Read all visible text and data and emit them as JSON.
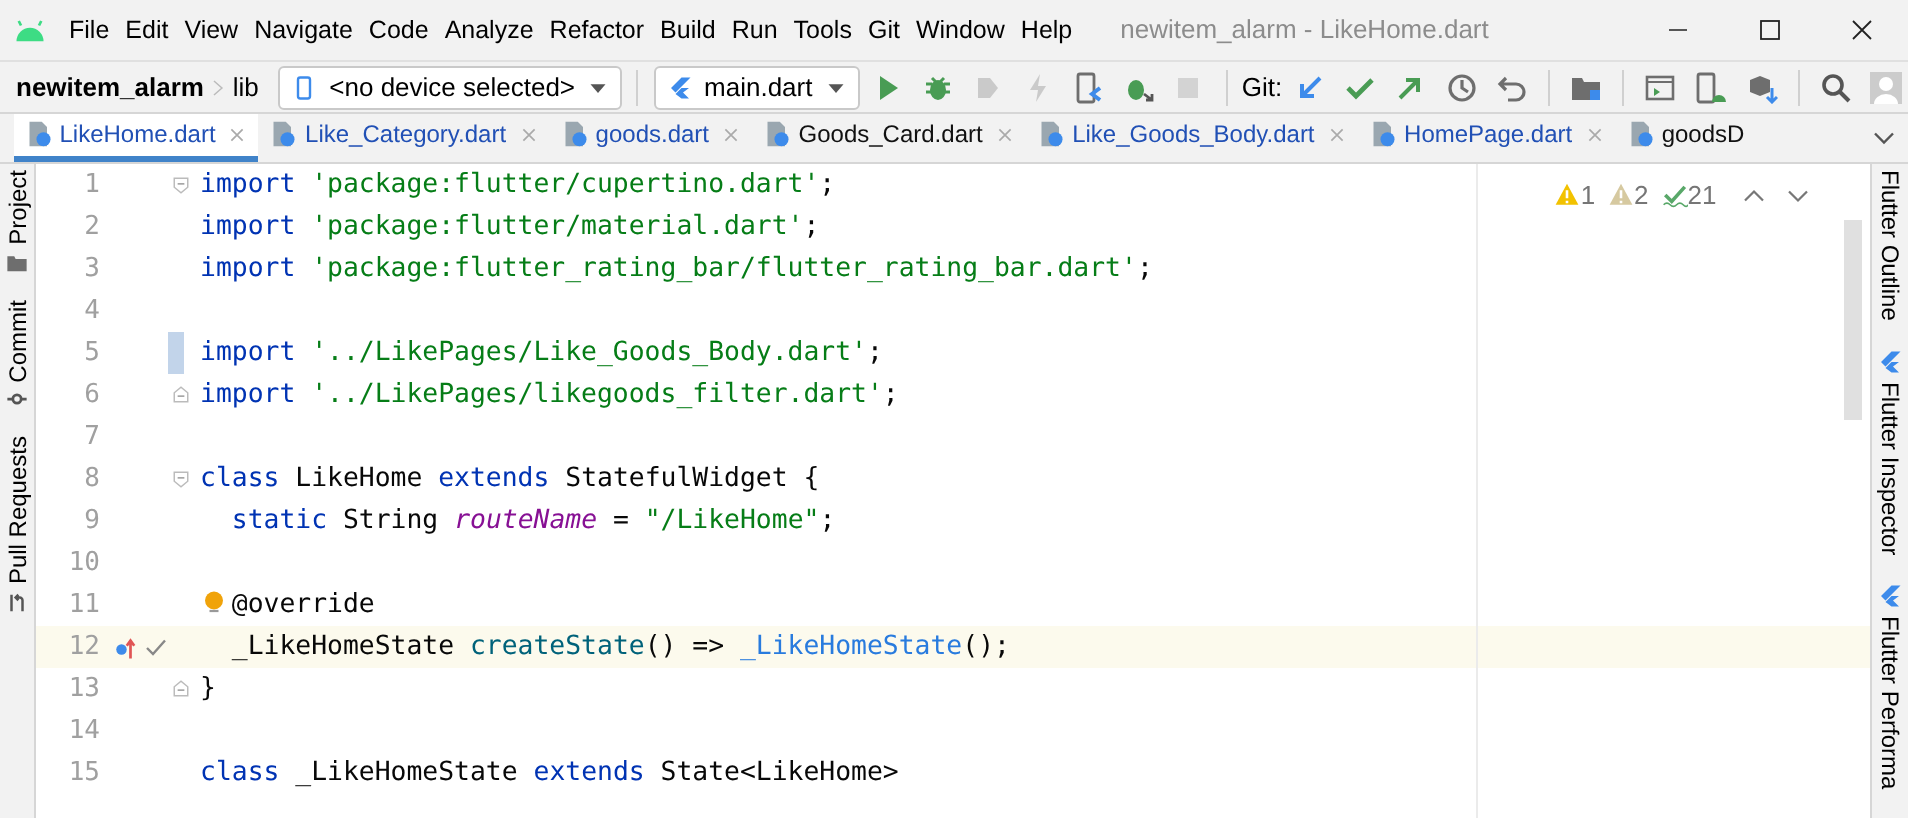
{
  "menu": [
    "File",
    "Edit",
    "View",
    "Navigate",
    "Code",
    "Analyze",
    "Refactor",
    "Build",
    "Run",
    "Tools",
    "Git",
    "Window",
    "Help"
  ],
  "window": {
    "title": "newitem_alarm - LikeHome.dart"
  },
  "breadcrumb": [
    "newitem_alarm",
    "lib"
  ],
  "device_selector": {
    "value": "<no device selected>"
  },
  "run_config": {
    "value": "main.dart"
  },
  "toolbar": [
    {
      "kind": "run",
      "disabled": false
    },
    {
      "kind": "debug",
      "disabled": false
    },
    {
      "kind": "profile",
      "disabled": true
    },
    {
      "kind": "reload",
      "disabled": true
    },
    {
      "kind": "attach",
      "disabled": false
    },
    {
      "kind": "debug-attach",
      "disabled": false
    },
    {
      "kind": "stop",
      "disabled": true
    }
  ],
  "git": {
    "label": "Git:",
    "icons": [
      {
        "kind": "update"
      },
      {
        "kind": "commit"
      },
      {
        "kind": "push"
      },
      {
        "kind": "history"
      },
      {
        "kind": "rollback"
      }
    ]
  },
  "toolbar_right": [
    {
      "kind": "structure"
    },
    {
      "kind": "device-manager"
    },
    {
      "kind": "sdk"
    },
    {
      "kind": "package"
    },
    {
      "kind": "search"
    },
    {
      "kind": "user"
    }
  ],
  "tabs": [
    {
      "label": "LikeHome.dart",
      "selected": true,
      "modified": true,
      "closable": true
    },
    {
      "label": "Like_Category.dart",
      "selected": false,
      "modified": true,
      "closable": true
    },
    {
      "label": "goods.dart",
      "selected": false,
      "modified": true,
      "closable": true
    },
    {
      "label": "Goods_Card.dart",
      "selected": false,
      "modified": false,
      "closable": true
    },
    {
      "label": "Like_Goods_Body.dart",
      "selected": false,
      "modified": true,
      "closable": true
    },
    {
      "label": "HomePage.dart",
      "selected": false,
      "modified": true,
      "closable": true
    },
    {
      "label": "goodsD",
      "selected": false,
      "modified": false,
      "closable": false
    }
  ],
  "left_stripe": [
    {
      "label": "Project",
      "kind": "folder"
    },
    {
      "label": "Commit",
      "kind": "commit"
    },
    {
      "label": "Pull Requests",
      "kind": "pull"
    }
  ],
  "right_stripe": [
    {
      "label": "Flutter Outline"
    },
    {
      "label": "Flutter Inspector"
    },
    {
      "label": "Flutter Performa"
    }
  ],
  "inspections": [
    {
      "kind": "warning",
      "count": "1"
    },
    {
      "kind": "weak",
      "count": "2"
    },
    {
      "kind": "typo",
      "count": "21"
    }
  ],
  "lines": [
    {
      "number": "1",
      "fold_open": true,
      "tokens": [
        {
          "kind": "kw",
          "text": "import"
        },
        {
          "kind": "str",
          "text": " 'package:flutter/cupertino.dart'"
        },
        {
          "kind": "plain",
          "text": ";"
        }
      ]
    },
    {
      "number": "2",
      "tokens": [
        {
          "kind": "kw",
          "text": "import"
        },
        {
          "kind": "str",
          "text": " 'package:flutter/material.dart'"
        },
        {
          "kind": "plain",
          "text": ";"
        }
      ]
    },
    {
      "number": "3",
      "tokens": [
        {
          "kind": "kw",
          "text": "import"
        },
        {
          "kind": "str",
          "text": " 'package:flutter_rating_bar/flutter_rating_bar.dart'"
        },
        {
          "kind": "plain",
          "text": ";"
        }
      ]
    },
    {
      "number": "4"
    },
    {
      "number": "5",
      "changed": true,
      "tokens": [
        {
          "kind": "kw",
          "text": "import"
        },
        {
          "kind": "str",
          "text": " '../LikePages/Like_Goods_Body.dart'"
        },
        {
          "kind": "plain",
          "text": ";"
        }
      ]
    },
    {
      "number": "6",
      "fold_close": true,
      "tokens": [
        {
          "kind": "kw",
          "text": "import"
        },
        {
          "kind": "str",
          "text": " '../LikePages/likegoods_filter.dart'"
        },
        {
          "kind": "plain",
          "text": ";"
        }
      ]
    },
    {
      "number": "7"
    },
    {
      "number": "8",
      "fold_open": true,
      "tokens": [
        {
          "kind": "kw",
          "text": "class"
        },
        {
          "kind": "plain",
          "text": " LikeHome "
        },
        {
          "kind": "kw",
          "text": "extends"
        },
        {
          "kind": "plain",
          "text": " StatefulWidget {"
        }
      ]
    },
    {
      "number": "9",
      "tokens": [
        {
          "kind": "kw",
          "text": "  static"
        },
        {
          "kind": "plain",
          "text": " String "
        },
        {
          "kind": "field",
          "text": "routeName"
        },
        {
          "kind": "plain",
          "text": " = "
        },
        {
          "kind": "str",
          "text": "\"/LikeHome\""
        },
        {
          "kind": "plain",
          "text": ";"
        }
      ]
    },
    {
      "number": "10"
    },
    {
      "number": "11",
      "bulb": true,
      "tokens": [
        {
          "kind": "plain",
          "text": "  @override"
        }
      ]
    },
    {
      "number": "12",
      "current": true,
      "markers": [
        {
          "kind": "override"
        },
        {
          "kind": "check"
        }
      ],
      "tokens": [
        {
          "kind": "plain",
          "text": "  _LikeHomeState "
        },
        {
          "kind": "method",
          "text": "createState"
        },
        {
          "kind": "plain",
          "text": "() => "
        },
        {
          "kind": "ctor",
          "text": "_LikeHomeState"
        },
        {
          "kind": "plain",
          "text": "();"
        }
      ]
    },
    {
      "number": "13",
      "fold_close": true,
      "tokens": [
        {
          "kind": "plain",
          "text": "}"
        }
      ]
    },
    {
      "number": "14"
    },
    {
      "number": "15",
      "tokens": [
        {
          "kind": "kw",
          "text": "class"
        },
        {
          "kind": "plain",
          "text": " _LikeHomeState "
        },
        {
          "kind": "kw",
          "text": "extends"
        },
        {
          "kind": "plain",
          "text": " State<LikeHome>"
        }
      ]
    }
  ]
}
